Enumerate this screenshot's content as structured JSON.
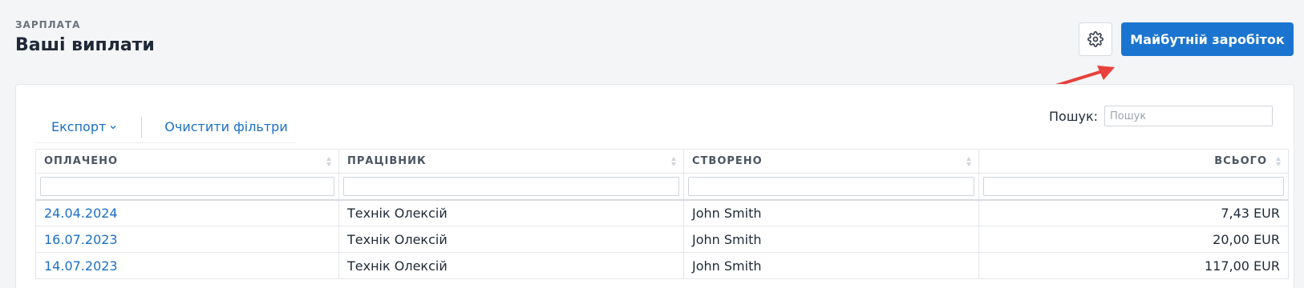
{
  "header": {
    "eyebrow": "ЗАРПЛАТА",
    "title": "Ваші виплати"
  },
  "actions": {
    "settings_icon": "gear-icon",
    "primary_label": "Майбутній заробіток"
  },
  "toolbar": {
    "export_label": "Експорт",
    "clear_filters_label": "Очистити фільтри"
  },
  "search": {
    "label": "Пошук:",
    "placeholder": "Пошук"
  },
  "table": {
    "columns": [
      "ОПЛАЧЕНО",
      "ПРАЦІВНИК",
      "СТВОРЕНО",
      "ВСЬОГО"
    ],
    "rows": [
      [
        "24.04.2024",
        "Технік Олексій",
        "John Smith",
        "7,43 EUR"
      ],
      [
        "16.07.2023",
        "Технік Олексій",
        "John Smith",
        "20,00 EUR"
      ],
      [
        "14.07.2023",
        "Технік Олексій",
        "John Smith",
        "117,00 EUR"
      ]
    ]
  },
  "colors": {
    "primary": "#1b75d0",
    "link": "#1b6fc8",
    "annotation_arrow": "#e8403a"
  }
}
